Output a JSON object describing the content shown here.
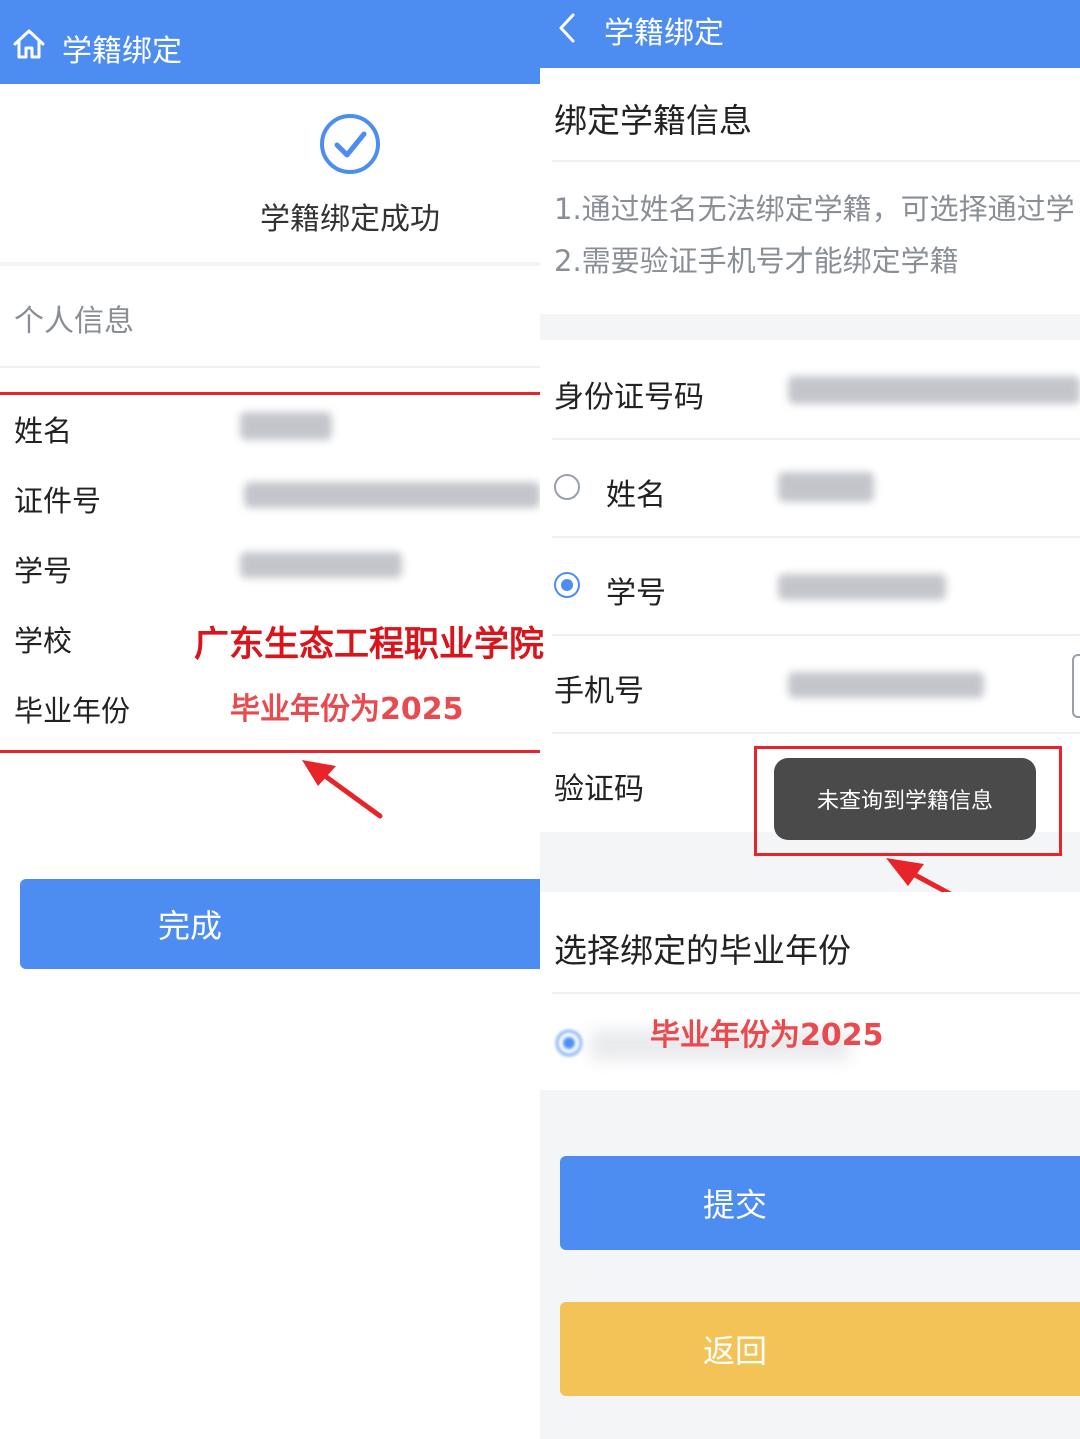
{
  "left": {
    "header": {
      "title": "学籍绑定",
      "icon": "home-icon"
    },
    "success": {
      "icon": "check-circle-icon",
      "text": "学籍绑定成功"
    },
    "section_title": "个人信息",
    "fields": [
      {
        "label": "姓名"
      },
      {
        "label": "证件号"
      },
      {
        "label": "学号"
      },
      {
        "label": "学校"
      },
      {
        "label": "毕业年份"
      }
    ],
    "school_annotation": "广东生态工程职业学院",
    "year_annotation": "毕业年份为2025",
    "done_button": "完成"
  },
  "right": {
    "header": {
      "title": "学籍绑定",
      "icon": "back-chevron-icon"
    },
    "section_title": "绑定学籍信息",
    "notes": [
      "1.通过姓名无法绑定学籍，可选择通过学",
      "2.需要验证手机号才能绑定学籍"
    ],
    "fields": {
      "id_number_label": "身份证号码",
      "name_label": "姓名",
      "student_no_label": "学号",
      "phone_label": "手机号",
      "code_label": "验证码"
    },
    "radio": {
      "name_selected": false,
      "student_no_selected": true
    },
    "toast": "未查询到学籍信息",
    "year_section_title": "选择绑定的毕业年份",
    "year_annotation": "毕业年份为2025",
    "submit_button": "提交",
    "back_button": "返回"
  },
  "colors": {
    "header_blue": "#4d8df2",
    "primary_button": "#4d8df2",
    "secondary_button": "#f3c357",
    "annotation_red": "#e8242b"
  }
}
